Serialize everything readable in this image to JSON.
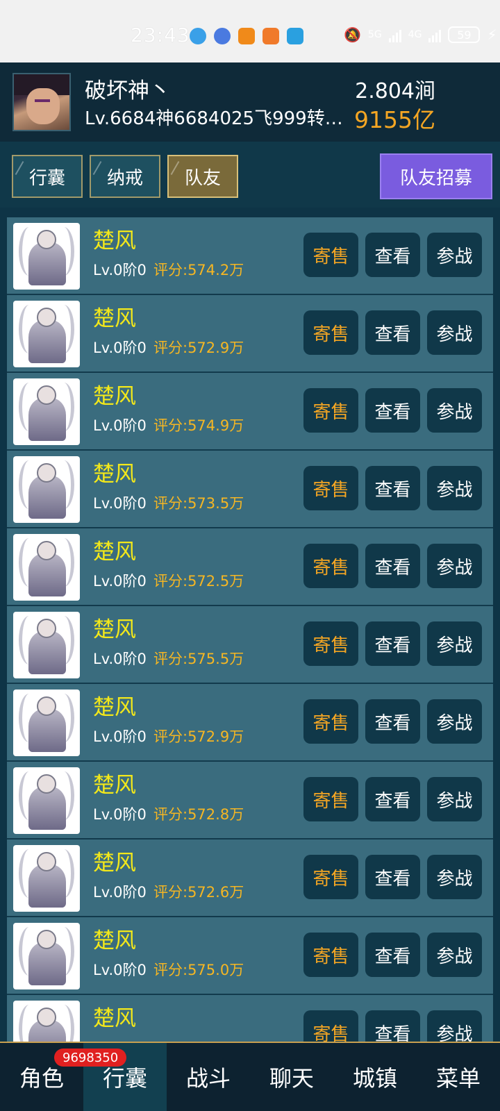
{
  "status_bar": {
    "time": "23:43",
    "network1": "5G",
    "network2": "4G",
    "battery": "59"
  },
  "header": {
    "player_name": "破坏神丶",
    "level_line": "Lv.6684神6684025飞999转5...",
    "currency1": "2.804涧",
    "currency2": "9155亿",
    "currency1_icon": "gold-ingot-icon",
    "currency2_icon": "crystal-icon"
  },
  "tabs": [
    {
      "label": "行囊",
      "active": false
    },
    {
      "label": "纳戒",
      "active": false
    },
    {
      "label": "队友",
      "active": true
    }
  ],
  "recruit_label": "队友招募",
  "buttons": {
    "sell": "寄售",
    "view": "查看",
    "join": "参战"
  },
  "companions": [
    {
      "name": "楚风",
      "level": "Lv.0阶0",
      "score": "评分:574.2万"
    },
    {
      "name": "楚风",
      "level": "Lv.0阶0",
      "score": "评分:572.9万"
    },
    {
      "name": "楚风",
      "level": "Lv.0阶0",
      "score": "评分:574.9万"
    },
    {
      "name": "楚风",
      "level": "Lv.0阶0",
      "score": "评分:573.5万"
    },
    {
      "name": "楚风",
      "level": "Lv.0阶0",
      "score": "评分:572.5万"
    },
    {
      "name": "楚风",
      "level": "Lv.0阶0",
      "score": "评分:575.5万"
    },
    {
      "name": "楚风",
      "level": "Lv.0阶0",
      "score": "评分:572.9万"
    },
    {
      "name": "楚风",
      "level": "Lv.0阶0",
      "score": "评分:572.8万"
    },
    {
      "name": "楚风",
      "level": "Lv.0阶0",
      "score": "评分:572.6万"
    },
    {
      "name": "楚风",
      "level": "Lv.0阶0",
      "score": "评分:575.0万"
    },
    {
      "name": "楚风",
      "level": "",
      "score": ""
    }
  ],
  "bottom_nav": {
    "items": [
      {
        "label": "角色",
        "active": false
      },
      {
        "label": "行囊",
        "active": true
      },
      {
        "label": "战斗",
        "active": false
      },
      {
        "label": "聊天",
        "active": false
      },
      {
        "label": "城镇",
        "active": false
      },
      {
        "label": "菜单",
        "active": false
      }
    ],
    "badge": "9698350"
  },
  "colors": {
    "name_yellow": "#f3e81a",
    "score_orange": "#f5b623",
    "recruit_purple": "#7a5cdf",
    "row_bg": "#3a6c7e"
  }
}
